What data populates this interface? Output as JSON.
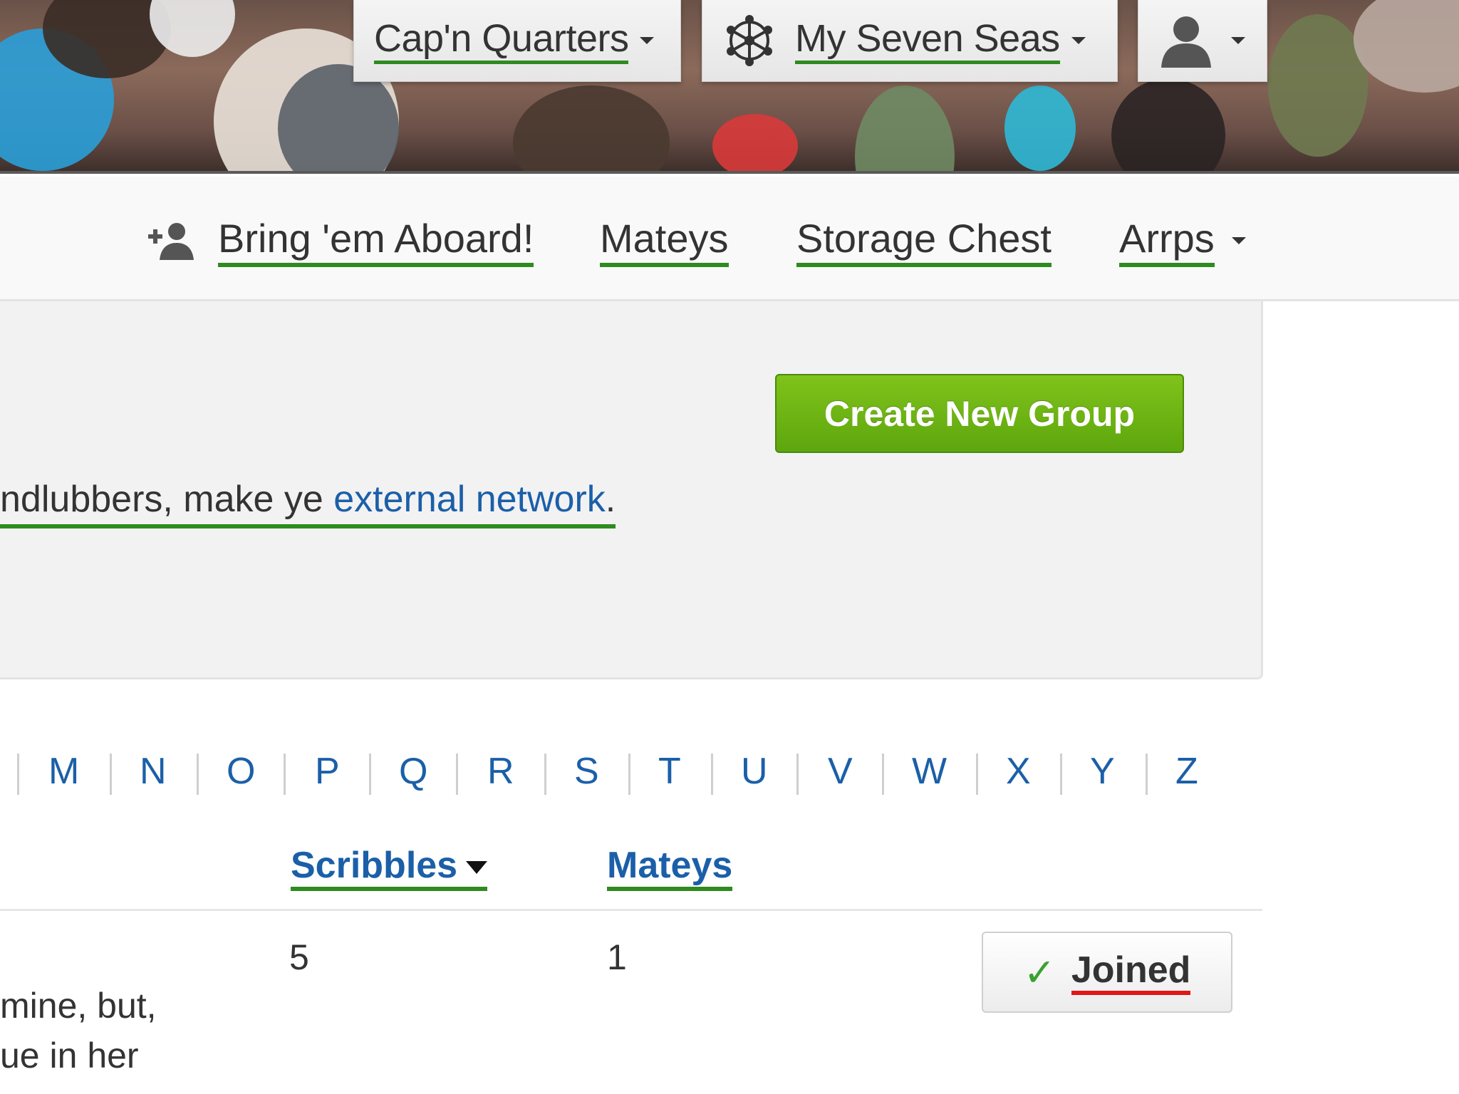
{
  "topnav": {
    "home_label": "Cap'n Quarters",
    "network_label": "My Seven Seas",
    "network_icon": "network-icon",
    "user_icon": "user-icon"
  },
  "subnav": {
    "invite_label": "Bring 'em Aboard!",
    "invite_icon": "add-person-icon",
    "people_label": "Mateys",
    "files_label": "Storage Chest",
    "apps_label": "Arrps"
  },
  "panel": {
    "create_group_label": "Create New Group",
    "text_prefix": "ndlubbers, make ye ",
    "link_text": "external network",
    "text_suffix": "."
  },
  "alphabet": [
    "M",
    "N",
    "O",
    "P",
    "Q",
    "R",
    "S",
    "T",
    "U",
    "V",
    "W",
    "X",
    "Y",
    "Z"
  ],
  "table": {
    "headers": {
      "scribbles": "Scribbles",
      "mateys": "Mateys"
    },
    "rows": [
      {
        "desc_line1": "mine, but,",
        "desc_line2": "ue in her",
        "scribbles": "5",
        "mateys": "1",
        "action_label": "Joined"
      }
    ]
  },
  "colors": {
    "accent_green": "#2e8b1f",
    "link_blue": "#1b5fa8",
    "button_green": "#6ab613",
    "red_underline": "#e01818"
  }
}
